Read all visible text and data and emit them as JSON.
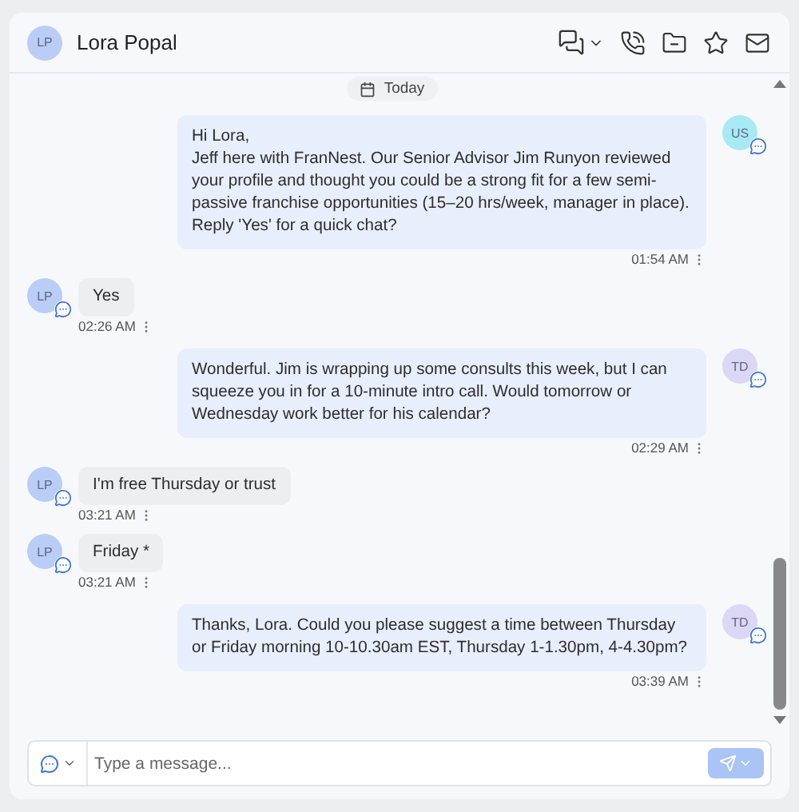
{
  "header": {
    "avatar": "LP",
    "name": "Lora Popal"
  },
  "date_divider": "Today",
  "messages": [
    {
      "kind": "outgoing",
      "avatar": "US",
      "color": "#a8eaf3",
      "text": "Hi Lora,\nJeff here with FranNest. Our Senior Advisor Jim Runyon reviewed your profile and thought you could be a strong fit for a few semi-passive franchise opportunities (15–20 hrs/week, manager in place). Reply 'Yes' for a quick chat?",
      "time": "01:54 AM"
    },
    {
      "kind": "incoming",
      "avatar": "LP",
      "color": "#b9cdf7",
      "text": "Yes",
      "time": "02:26 AM"
    },
    {
      "kind": "outgoing",
      "avatar": "TD",
      "color": "#dcd7f5",
      "text": "Wonderful. Jim is wrapping up some consults this week, but I can squeeze you in for a 10-minute intro call. Would tomorrow or Wednesday work better for his calendar?",
      "time": "02:29 AM"
    },
    {
      "kind": "incoming",
      "avatar": "LP",
      "color": "#b9cdf7",
      "text": "I'm free Thursday or trust",
      "time": "03:21 AM"
    },
    {
      "kind": "incoming",
      "avatar": "LP",
      "color": "#b9cdf7",
      "text": "Friday *",
      "time": "03:21 AM"
    },
    {
      "kind": "outgoing",
      "avatar": "TD",
      "color": "#dcd7f5",
      "text": "Thanks, Lora. Could you please suggest a time between Thursday or Friday morning 10-10.30am EST, Thursday 1-1.30pm, 4-4.30pm?",
      "time": "03:39 AM"
    }
  ],
  "composer": {
    "placeholder": "Type a message..."
  }
}
